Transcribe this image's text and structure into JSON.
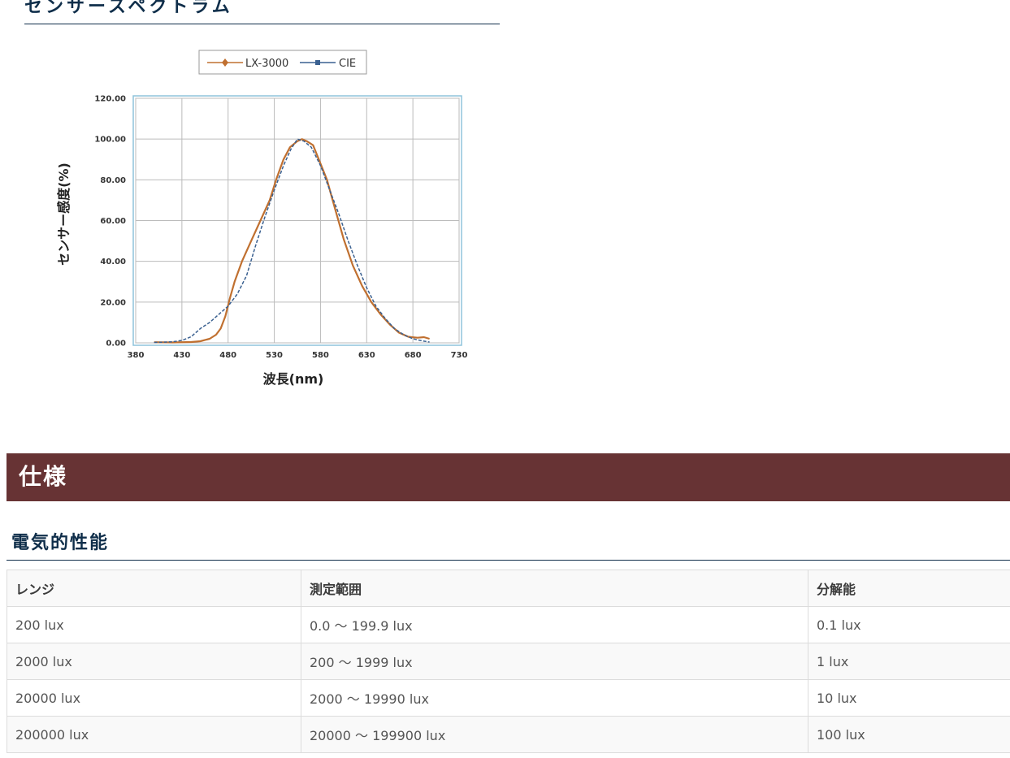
{
  "sections": {
    "spectrum_title": "センサースペクトラム",
    "spec_banner": "仕様",
    "electrical_title": "電気的性能"
  },
  "chart_data": {
    "type": "line",
    "xlabel": "波長(nm)",
    "ylabel": "センサー感度(%)",
    "xlim": [
      380,
      730
    ],
    "ylim": [
      0,
      120
    ],
    "x_ticks": [
      "380",
      "430",
      "480",
      "530",
      "580",
      "630",
      "680",
      "730"
    ],
    "y_ticks": [
      "0.00",
      "20.00",
      "40.00",
      "60.00",
      "80.00",
      "100.00",
      "120.00"
    ],
    "grid": true,
    "legend_position": "top",
    "series": [
      {
        "name": "LX-3000",
        "color": "#c07030",
        "style": "solid",
        "points": [
          [
            400,
            0.3
          ],
          [
            420,
            0.2
          ],
          [
            440,
            0.4
          ],
          [
            450,
            0.8
          ],
          [
            460,
            2
          ],
          [
            467,
            4
          ],
          [
            472,
            7
          ],
          [
            477,
            13
          ],
          [
            482,
            22
          ],
          [
            487,
            30
          ],
          [
            495,
            40
          ],
          [
            505,
            50
          ],
          [
            515,
            60
          ],
          [
            525,
            70
          ],
          [
            532,
            80
          ],
          [
            540,
            90
          ],
          [
            547,
            96
          ],
          [
            555,
            99
          ],
          [
            560,
            100
          ],
          [
            565,
            99
          ],
          [
            572,
            97
          ],
          [
            580,
            88
          ],
          [
            587,
            80
          ],
          [
            595,
            67
          ],
          [
            605,
            51
          ],
          [
            615,
            38
          ],
          [
            625,
            28
          ],
          [
            635,
            20
          ],
          [
            645,
            14
          ],
          [
            655,
            9
          ],
          [
            665,
            5
          ],
          [
            675,
            3
          ],
          [
            685,
            2.5
          ],
          [
            692,
            2.8
          ],
          [
            698,
            2
          ]
        ]
      },
      {
        "name": "CIE",
        "color": "#3a6090",
        "style": "dashed",
        "points": [
          [
            400,
            0.2
          ],
          [
            410,
            0.3
          ],
          [
            420,
            0.5
          ],
          [
            430,
            1.2
          ],
          [
            440,
            3
          ],
          [
            450,
            7
          ],
          [
            460,
            10
          ],
          [
            470,
            14
          ],
          [
            480,
            18
          ],
          [
            490,
            24
          ],
          [
            500,
            33
          ],
          [
            510,
            48
          ],
          [
            520,
            62
          ],
          [
            530,
            75
          ],
          [
            540,
            87
          ],
          [
            548,
            95
          ],
          [
            555,
            100
          ],
          [
            562,
            99
          ],
          [
            570,
            96
          ],
          [
            580,
            87
          ],
          [
            590,
            75
          ],
          [
            600,
            63
          ],
          [
            610,
            50
          ],
          [
            620,
            38
          ],
          [
            630,
            27
          ],
          [
            640,
            18
          ],
          [
            650,
            12
          ],
          [
            660,
            7
          ],
          [
            670,
            4
          ],
          [
            680,
            2
          ],
          [
            690,
            1
          ],
          [
            698,
            0.4
          ]
        ]
      }
    ]
  },
  "table": {
    "headers": [
      "レンジ",
      "測定範囲",
      "分解能"
    ],
    "rows": [
      [
        "200 lux",
        "0.0 〜 199.9 lux",
        "0.1 lux"
      ],
      [
        "2000 lux",
        "200 〜 1999 lux",
        "1 lux"
      ],
      [
        "20000 lux",
        "2000 〜 19990 lux",
        "10 lux"
      ],
      [
        "200000 lux",
        "20000 〜 199900 lux",
        "100 lux"
      ]
    ]
  }
}
